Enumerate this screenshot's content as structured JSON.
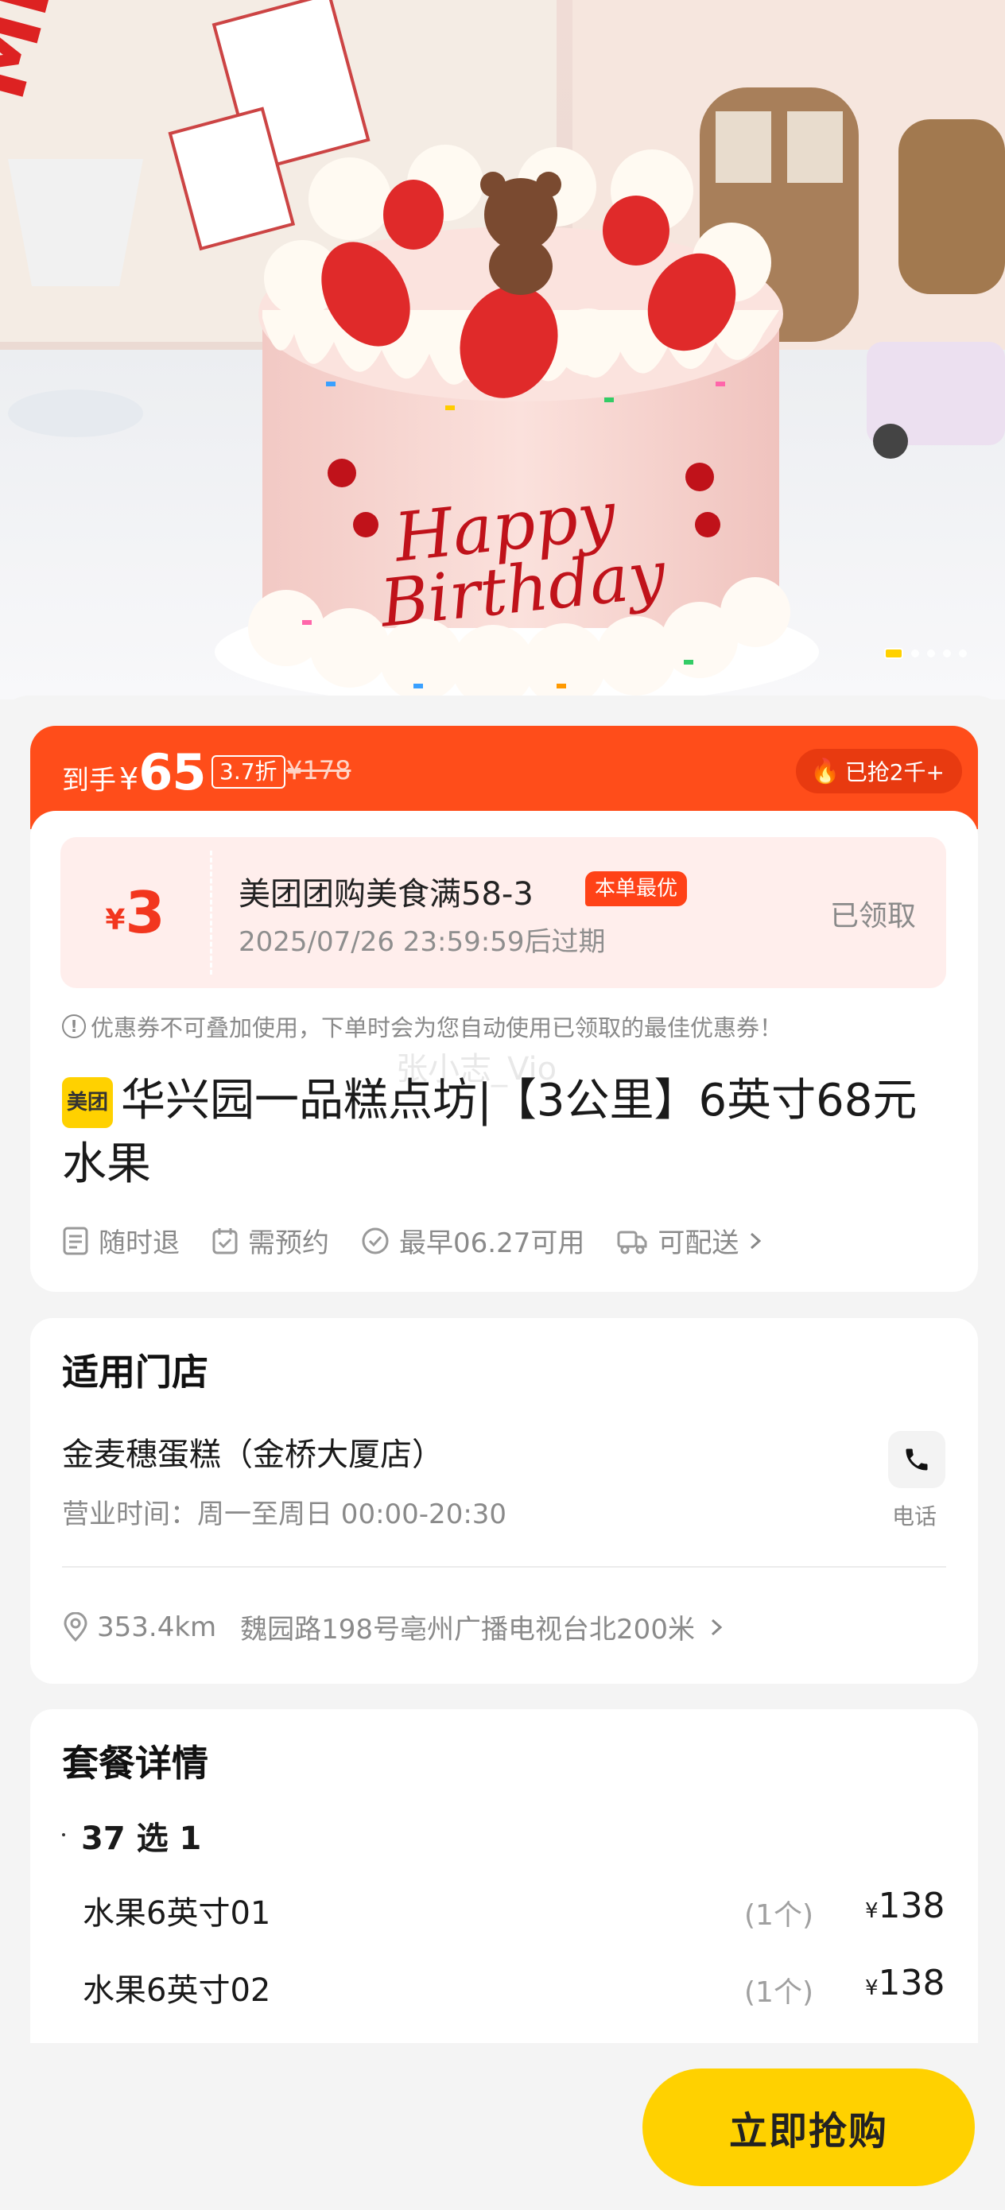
{
  "hero": {
    "slide_count": 5,
    "active_slide": 1,
    "cake_text": "Happy Birthday"
  },
  "price": {
    "prefix": "到手",
    "currency": "¥",
    "value": "65",
    "discount": "3.7折",
    "original": "¥178",
    "sold": "已抢2千+"
  },
  "coupon": {
    "currency": "¥",
    "amount": "3",
    "title": "美团团购美食满58-3",
    "best_tag": "本单最优",
    "expiry": "2025/07/26 23:59:59后过期",
    "status": "已领取"
  },
  "tip": "优惠券不可叠加使用，下单时会为您自动使用已领取的最佳优惠券！",
  "watermark": "张小志_Vio",
  "product": {
    "logo": "美团",
    "title": "华兴园一品糕点坊|【3公里】6英寸68元水果"
  },
  "features": [
    "随时退",
    "需预约",
    "最早06.27可用",
    "可配送"
  ],
  "stores": {
    "section_title": "适用门店",
    "name": "金麦穗蛋糕（金桥大厦店）",
    "hours": "营业时间：周一至周日 00:00-20:30",
    "phone_label": "电话",
    "distance": "353.4km",
    "address": "魏园路198号亳州广播电视台北200米"
  },
  "package": {
    "section_title": "套餐详情",
    "choose": "37 选 1",
    "items": [
      {
        "name": "水果6英寸01",
        "qty": "(1个)",
        "currency": "¥",
        "price": "138"
      },
      {
        "name": "水果6英寸02",
        "qty": "(1个)",
        "currency": "¥",
        "price": "138"
      }
    ]
  },
  "actions": {
    "buy": "立即抢购"
  }
}
